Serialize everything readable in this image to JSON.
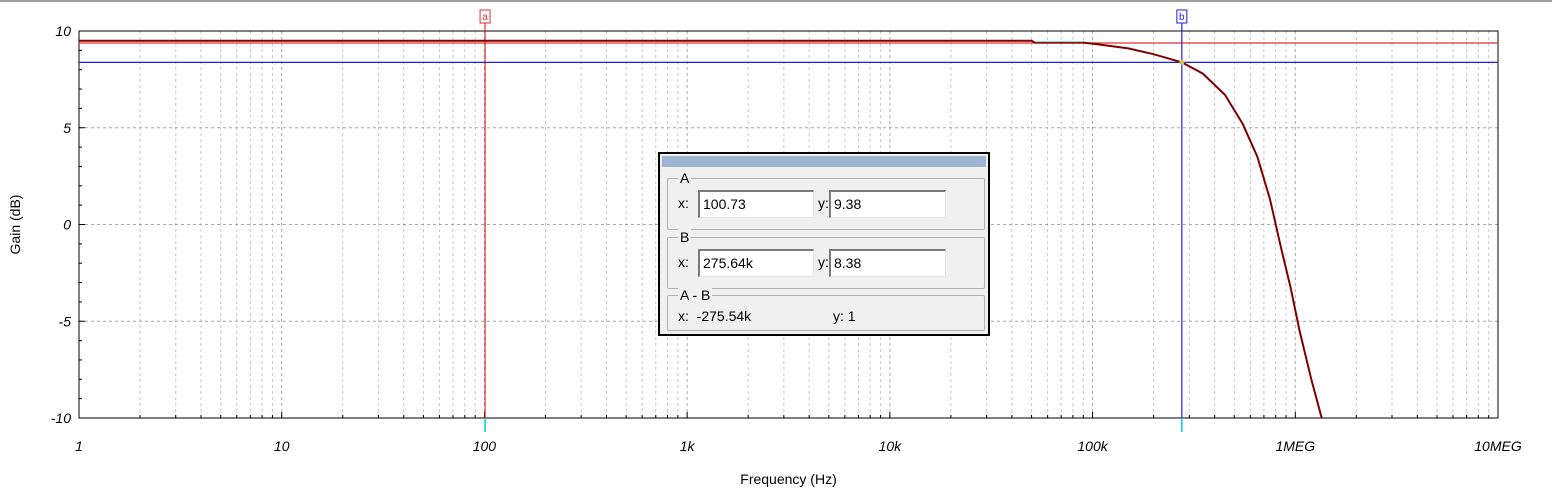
{
  "chart_data": {
    "type": "line",
    "xlabel": "Frequency (Hz)",
    "ylabel": "Gain (dB)",
    "x_scale": "log",
    "xlim": [
      1,
      10000000
    ],
    "ylim": [
      -10,
      10
    ],
    "grid": true,
    "x_ticks": [
      {
        "value": 1,
        "label": "1"
      },
      {
        "value": 10,
        "label": "10"
      },
      {
        "value": 100,
        "label": "100"
      },
      {
        "value": 1000,
        "label": "1k"
      },
      {
        "value": 10000,
        "label": "10k"
      },
      {
        "value": 100000,
        "label": "100k"
      },
      {
        "value": 1000000,
        "label": "1MEG"
      },
      {
        "value": 10000000,
        "label": "10MEG"
      }
    ],
    "y_ticks": [
      {
        "value": 10,
        "label": "10"
      },
      {
        "value": 5,
        "label": "5"
      },
      {
        "value": 0,
        "label": "0"
      },
      {
        "value": -5,
        "label": "-5"
      },
      {
        "value": -10,
        "label": "-10"
      }
    ],
    "series": [
      {
        "color": "#800000",
        "x": [
          1,
          50000,
          52000,
          90000,
          100000,
          150000,
          200000,
          275640,
          350000,
          450000,
          550000,
          650000,
          750000,
          850000,
          950000,
          1050000,
          1200000,
          1350000
        ],
        "y": [
          9.5,
          9.5,
          9.4,
          9.4,
          9.35,
          9.1,
          8.8,
          8.38,
          7.8,
          6.7,
          5.2,
          3.5,
          1.3,
          -1.2,
          -3.3,
          -5.5,
          -8.0,
          -10.0
        ]
      }
    ],
    "cursors": [
      {
        "label": "a",
        "x": 100.73,
        "y": 9.38,
        "color": "#e03030"
      },
      {
        "label": "b",
        "x": 275640,
        "y": 8.38,
        "color": "#2020e0"
      }
    ]
  },
  "readout": {
    "a": {
      "name": "A",
      "x_label": "x:",
      "y_label": "y:",
      "x_value": "100.73",
      "y_value": "9.38"
    },
    "b": {
      "name": "B",
      "x_label": "x:",
      "y_label": "y:",
      "x_value": "275.64k",
      "y_value": "8.38"
    },
    "diff": {
      "name": "A - B",
      "x_text": "x:  -275.54k",
      "y_text": "y: 1"
    }
  }
}
